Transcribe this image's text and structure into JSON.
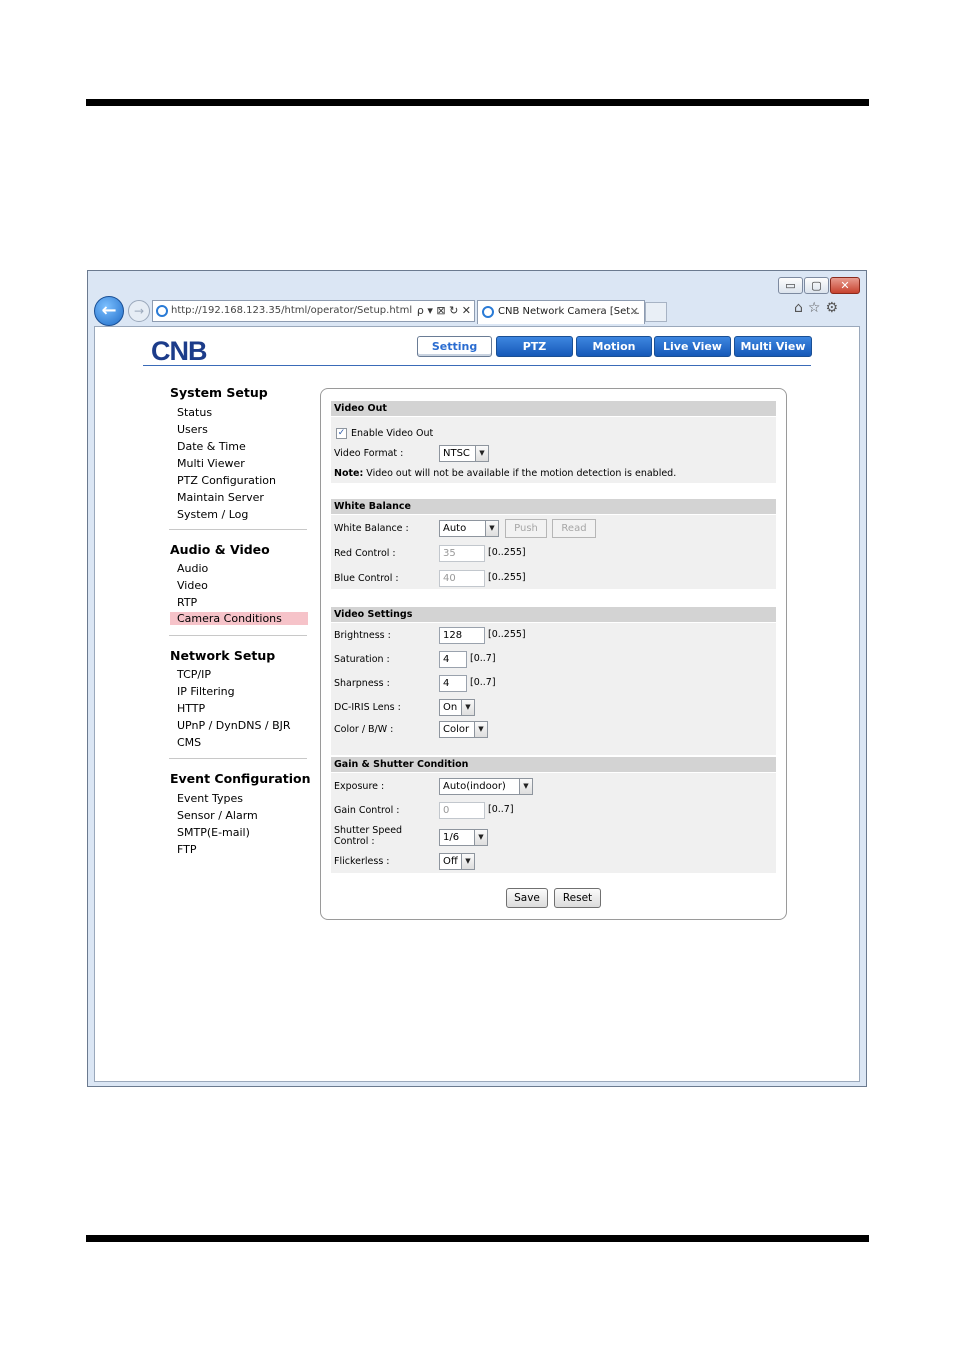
{
  "browser": {
    "window_buttons": {
      "minimize": "▭",
      "maximize": "▢",
      "close": "✕"
    },
    "back_glyph": "←",
    "forward_glyph": "→",
    "url": "http://192.168.123.35/html/operator/Setup.html",
    "address_tools": "ρ ▾ ⊠ ↻ ✕",
    "tab_title": "CNB Network Camera [Set...",
    "tab_close": "✕",
    "right_icons": "⌂☆⚙"
  },
  "logo_text": "CNB",
  "nav": {
    "tabs": [
      {
        "label": "Setting",
        "active": true
      },
      {
        "label": "PTZ"
      },
      {
        "label": "Motion"
      },
      {
        "label": "Live View"
      },
      {
        "label": "Multi View"
      }
    ]
  },
  "sidebar": {
    "system_setup": {
      "heading": "System Setup",
      "items": [
        "Status",
        "Users",
        "Date & Time",
        "Multi Viewer",
        "PTZ Configuration",
        "Maintain Server",
        "System / Log"
      ]
    },
    "audio_video": {
      "heading": "Audio & Video",
      "items": [
        "Audio",
        "Video",
        "RTP",
        "Camera Conditions"
      ],
      "selected": "Camera Conditions"
    },
    "network_setup": {
      "heading": "Network Setup",
      "items": [
        "TCP/IP",
        "IP Filtering",
        "HTTP",
        "UPnP / DynDNS / BJR",
        "CMS"
      ]
    },
    "event_configuration": {
      "heading": "Event Configuration",
      "items": [
        "Event Types",
        "Sensor / Alarm",
        "SMTP(E-mail)",
        "FTP"
      ]
    }
  },
  "video_out": {
    "title": "Video Out",
    "enable_label": "Enable Video Out",
    "enable_checked": true,
    "check_glyph": "✓",
    "format_label": "Video Format :",
    "format_value": "NTSC",
    "note_bold": "Note:",
    "note_text": " Video out will not be available if the motion detection is enabled."
  },
  "white_balance": {
    "title": "White Balance",
    "wb_label": "White Balance :",
    "wb_value": "Auto",
    "push_label": "Push",
    "read_label": "Read",
    "red_label": "Red Control :",
    "red_value": "35",
    "red_range": "[0..255]",
    "blue_label": "Blue Control :",
    "blue_value": "40",
    "blue_range": "[0..255]"
  },
  "video_settings": {
    "title": "Video Settings",
    "brightness_label": "Brightness :",
    "brightness_value": "128",
    "brightness_range": "[0..255]",
    "saturation_label": "Saturation :",
    "saturation_value": "4",
    "saturation_range": "[0..7]",
    "sharpness_label": "Sharpness :",
    "sharpness_value": "4",
    "sharpness_range": "[0..7]",
    "iris_label": "DC-IRIS Lens :",
    "iris_value": "On",
    "color_label": "Color / B/W :",
    "color_value": "Color"
  },
  "gain_shutter": {
    "title": "Gain & Shutter Condition",
    "exposure_label": "Exposure :",
    "exposure_value": "Auto(indoor)",
    "gain_label": "Gain Control :",
    "gain_value": "0",
    "gain_range": "[0..7]",
    "shutter_label_1": "Shutter Speed",
    "shutter_label_2": "Control :",
    "shutter_value": "1/6",
    "flicker_label": "Flickerless :",
    "flicker_value": "Off"
  },
  "select_arrow": "▼",
  "actions": {
    "save": "Save",
    "reset": "Reset"
  },
  "colors": {
    "nav_blue": "#1f63c4",
    "selected_item": "#f6c3c9",
    "section_header": "#d3d3d3"
  }
}
